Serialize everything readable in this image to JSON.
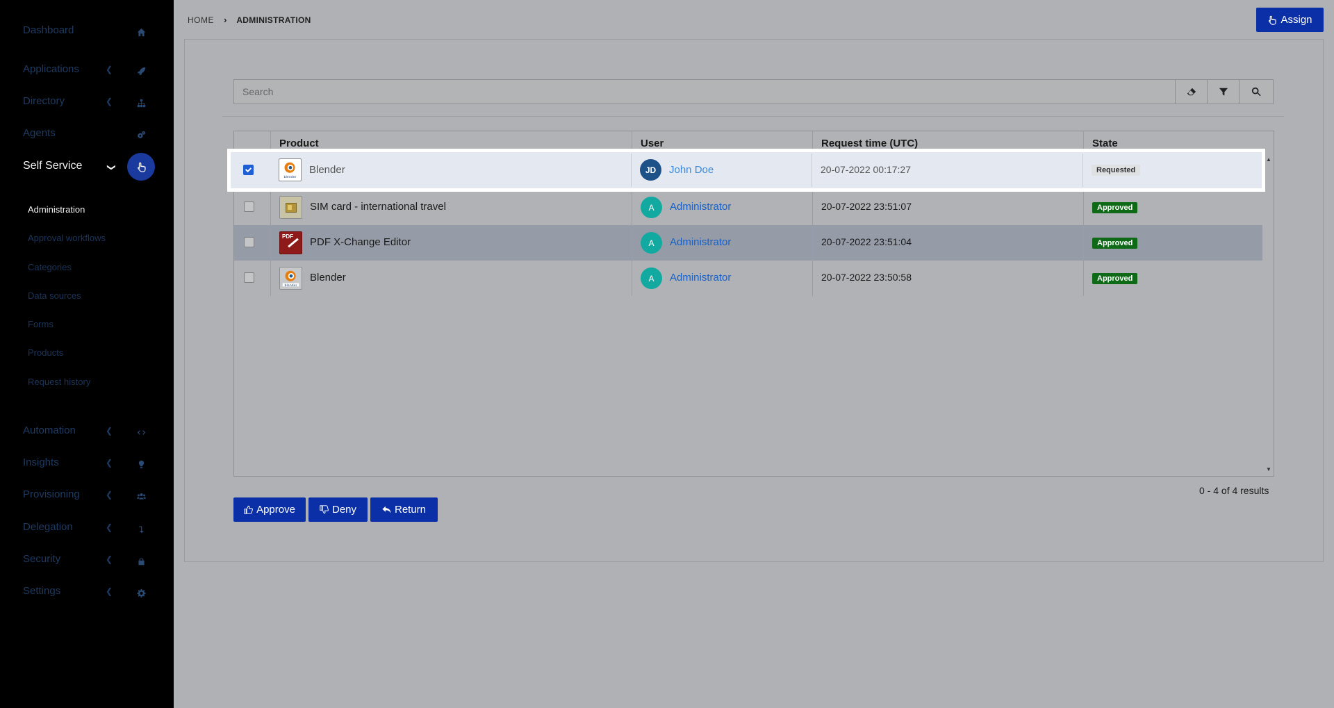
{
  "sidebar": {
    "items": [
      {
        "label": "Dashboard",
        "icon": "home-icon"
      },
      {
        "label": "Applications",
        "icon": "rocket-icon"
      },
      {
        "label": "Directory",
        "icon": "sitemap-icon"
      },
      {
        "label": "Agents",
        "icon": "cogs-icon"
      },
      {
        "label": "Self Service",
        "icon": "hand-pointer-icon"
      },
      {
        "label": "Automation",
        "icon": "code-icon"
      },
      {
        "label": "Insights",
        "icon": "lightbulb-icon"
      },
      {
        "label": "Provisioning",
        "icon": "users-icon"
      },
      {
        "label": "Delegation",
        "icon": "level-down-icon"
      },
      {
        "label": "Security",
        "icon": "lock-icon"
      },
      {
        "label": "Settings",
        "icon": "gear-icon"
      }
    ],
    "subitems": [
      "Administration",
      "Approval workflows",
      "Categories",
      "Data sources",
      "Forms",
      "Products",
      "Request history"
    ]
  },
  "breadcrumb": {
    "home": "HOME",
    "current": "ADMINISTRATION"
  },
  "header": {
    "assign_label": "Assign"
  },
  "search": {
    "placeholder": "Search"
  },
  "table": {
    "headers": [
      "Product",
      "User",
      "Request time (UTC)",
      "State"
    ],
    "rows": [
      {
        "product": "Blender",
        "user": "John Doe",
        "initials": "JD",
        "time": "20-07-2022 00:17:27",
        "state": "Requested"
      },
      {
        "product": "SIM card - international travel",
        "user": "Administrator",
        "initials": "A",
        "time": "20-07-2022 23:51:07",
        "state": "Approved"
      },
      {
        "product": "PDF X-Change Editor",
        "user": "Administrator",
        "initials": "A",
        "time": "20-07-2022 23:51:04",
        "state": "Approved"
      },
      {
        "product": "Blender",
        "user": "Administrator",
        "initials": "A",
        "time": "20-07-2022 23:50:58",
        "state": "Approved"
      }
    ]
  },
  "pagination": {
    "results": "0 - 4 of 4 results"
  },
  "actions": {
    "approve": "Approve",
    "deny": "Deny",
    "return": "Return"
  },
  "colors": {
    "accent": "#0b2fa6",
    "approved": "#0f6a17",
    "link": "#1660c9"
  }
}
